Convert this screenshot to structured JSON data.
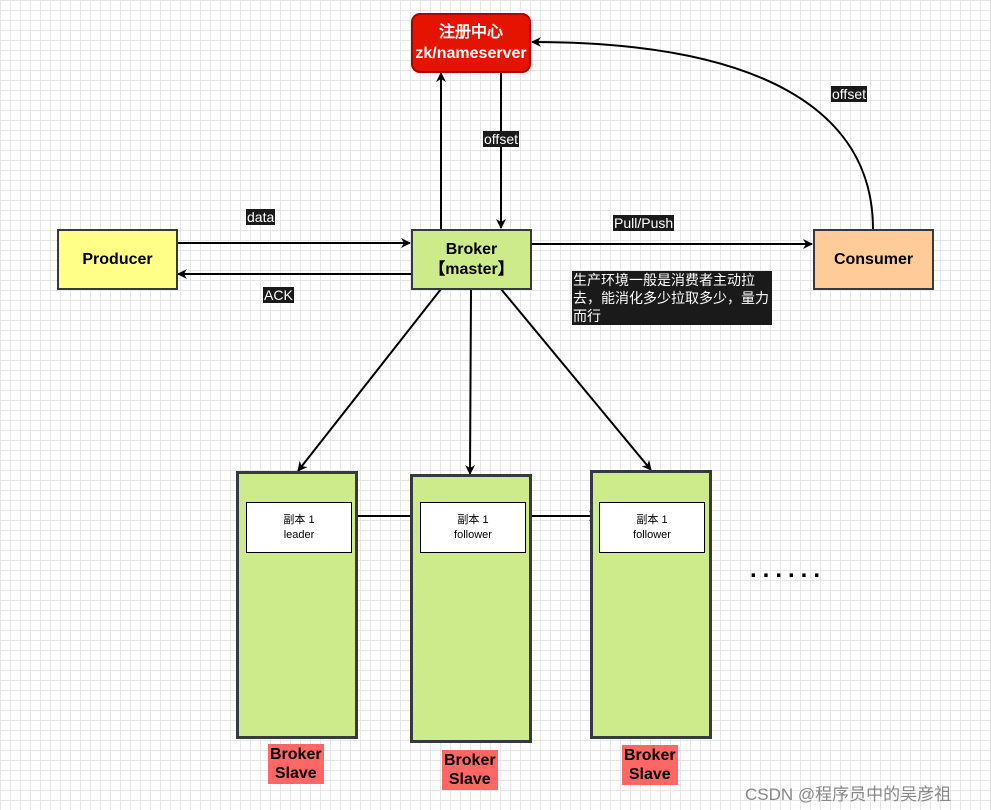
{
  "registry": {
    "line1": "注册中心",
    "line2": "zk/nameserver",
    "color": "#e51400"
  },
  "producer": {
    "label": "Producer",
    "color": "#ffff88"
  },
  "broker_master": {
    "line1": "Broker",
    "line2": "【master】",
    "color": "#cdeb8b"
  },
  "consumer": {
    "label": "Consumer",
    "color": "#ffcc99"
  },
  "edge_labels": {
    "data": "data",
    "ack": "ACK",
    "pull_push": "Pull/Push",
    "offset_broker": "offset",
    "offset_consumer": "offset"
  },
  "note": "生产环境一般是消费者主动拉去，能消化多少拉取多少，量力而行",
  "slaves": [
    {
      "replica_line1": "副本 1",
      "replica_line2": "leader",
      "label_line1": "Broker",
      "label_line2": "Slave"
    },
    {
      "replica_line1": "副本 1",
      "replica_line2": "follower",
      "label_line1": "Broker",
      "label_line2": "Slave"
    },
    {
      "replica_line1": "副本 1",
      "replica_line2": "follower",
      "label_line1": "Broker",
      "label_line2": "Slave"
    }
  ],
  "ellipsis": "......",
  "watermark": "CSDN @程序员中的吴彦祖"
}
